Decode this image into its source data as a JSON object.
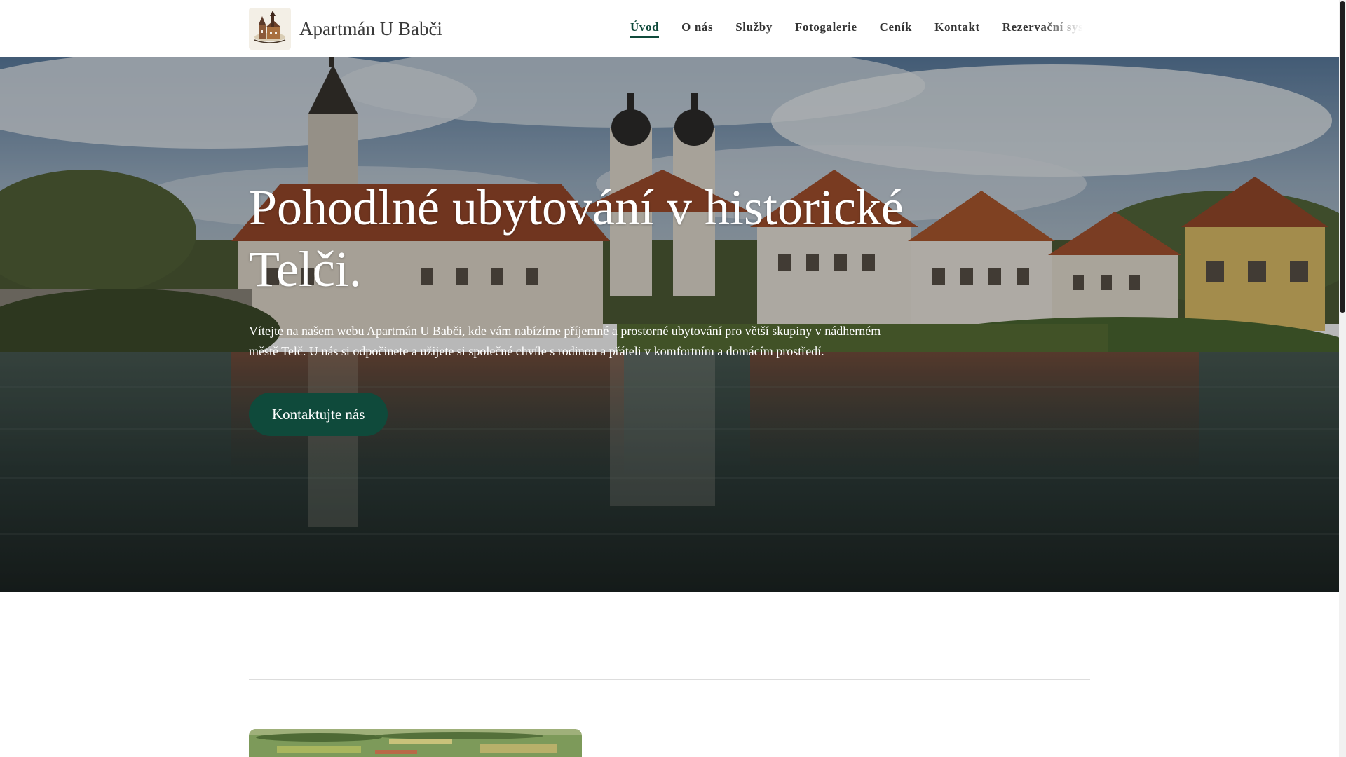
{
  "brand": {
    "name": "Apartmán U Babči",
    "logo_icon": "church-sketch-icon"
  },
  "nav": {
    "items": [
      {
        "label": "Úvod",
        "active": true
      },
      {
        "label": "O nás",
        "active": false
      },
      {
        "label": "Služby",
        "active": false
      },
      {
        "label": "Fotogalerie",
        "active": false
      },
      {
        "label": "Ceník",
        "active": false
      },
      {
        "label": "Kontakt",
        "active": false
      },
      {
        "label": "Rezervační systém",
        "active": false
      }
    ]
  },
  "hero": {
    "title": "Pohodlné ubytování v historické Telči.",
    "text": "Vítejte na našem webu Apartmán U Babči, kde vám nabízíme příjemné a prostorné ubytování pro větší skupiny v nádherném městě Telč. U nás si odpočinete a užijete si společné chvíle s rodinou a přáteli v komfortním a domácím prostředí.",
    "button_label": "Kontaktujte nás",
    "background": "town-by-lake-photo"
  },
  "colors": {
    "accent": "#0f4a3b",
    "nav_text": "#333333",
    "brand_text": "#3a3a3a"
  }
}
